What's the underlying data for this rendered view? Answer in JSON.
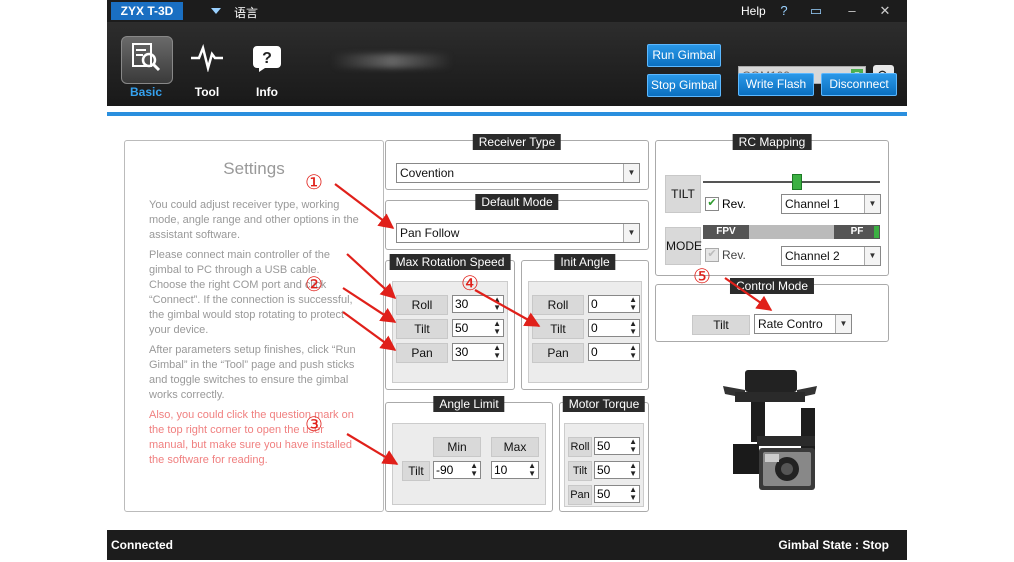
{
  "app": {
    "title": "ZYX T-3D",
    "language_label": "语言",
    "help_label": "Help"
  },
  "nav": [
    {
      "label": "Basic"
    },
    {
      "label": "Tool"
    },
    {
      "label": "Info"
    }
  ],
  "toolbar": {
    "run_gimbal": "Run Gimbal",
    "stop_gimbal": "Stop Gimbal",
    "write_flash": "Write Flash",
    "disconnect": "Disconnect",
    "com_port": "COM109"
  },
  "settings": {
    "title": "Settings",
    "p1": "You could adjust receiver type, working mode, angle range and other options in the assistant software.",
    "p2": "Please connect main controller of the gimbal to PC through a USB cable. Choose the right COM port and click “Connect”. If the connection is successful, the gimbal would stop rotating to protect your device.",
    "p3": "After parameters setup finishes, click “Run Gimbal” in the “Tool” page and push sticks and toggle switches to ensure the gimbal works correctly.",
    "p4": "Also, you could click the question mark on the top right corner to open the user manual, but make sure you have installed the software for reading."
  },
  "receiver": {
    "title": "Receiver Type",
    "value": "Covention"
  },
  "default_mode": {
    "title": "Default Mode",
    "value": "Pan Follow"
  },
  "max_rotation": {
    "title": "Max Rotation Speed",
    "rows": [
      {
        "label": "Roll",
        "value": "30"
      },
      {
        "label": "Tilt",
        "value": "50"
      },
      {
        "label": "Pan",
        "value": "30"
      }
    ]
  },
  "init_angle": {
    "title": "Init Angle",
    "rows": [
      {
        "label": "Roll",
        "value": "0"
      },
      {
        "label": "Tilt",
        "value": "0"
      },
      {
        "label": "Pan",
        "value": "0"
      }
    ]
  },
  "angle_limit": {
    "title": "Angle Limit",
    "min_label": "Min",
    "max_label": "Max",
    "row_label": "Tilt",
    "min": "-90",
    "max": "10"
  },
  "motor_torque": {
    "title": "Motor Torque",
    "rows": [
      {
        "label": "Roll",
        "value": "50"
      },
      {
        "label": "Tilt",
        "value": "50"
      },
      {
        "label": "Pan",
        "value": "50"
      }
    ]
  },
  "rc_mapping": {
    "title": "RC Mapping",
    "tilt_label": "TILT",
    "mode_label": "MODE",
    "rev_label": "Rev.",
    "tilt_channel": "Channel 1",
    "mode_channel": "Channel 2",
    "fpv": "FPV",
    "pf": "PF"
  },
  "control_mode": {
    "title": "Control Mode",
    "axis": "Tilt",
    "value": "Rate Contro"
  },
  "annotations": [
    "①",
    "②",
    "③",
    "④",
    "⑤"
  ],
  "status": {
    "left": "Connected",
    "right": "Gimbal State : Stop"
  },
  "colors": {
    "accent": "#2a8fde",
    "arrow": "#e0201a"
  }
}
